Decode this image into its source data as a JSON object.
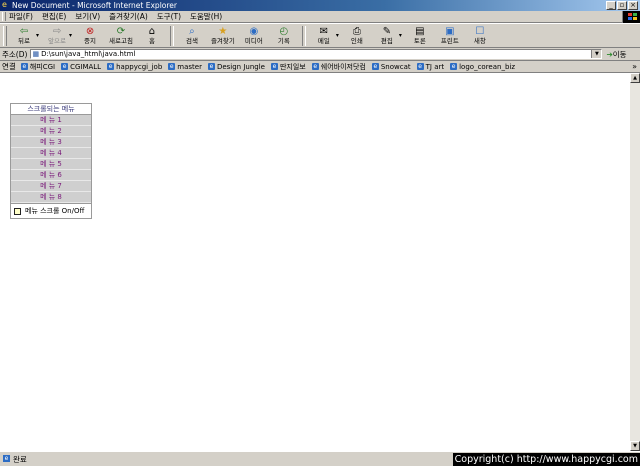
{
  "window": {
    "title": "New Document - Microsoft Internet Explorer",
    "controls": [
      "_",
      "▫",
      "×"
    ]
  },
  "menubar": [
    "파일(F)",
    "편집(E)",
    "보기(V)",
    "즐겨찾기(A)",
    "도구(T)",
    "도움말(H)"
  ],
  "toolbar": {
    "back": "뒤로",
    "forward": "앞으로",
    "stop": "중지",
    "refresh": "새로고침",
    "home": "홈",
    "search": "검색",
    "favorites": "즐겨찾기",
    "media": "미디어",
    "history": "기록",
    "mail": "메일",
    "print": "인쇄",
    "edit": "편집",
    "discuss": "토론",
    "print2": "프린트",
    "messenger": "새창"
  },
  "address": {
    "label": "주소(D)",
    "url": "D:\\sun\\java_html\\java.html",
    "go": "이동"
  },
  "links": {
    "label": "연결",
    "items": [
      "해피CGI",
      "CGIMALL",
      "happycgi_job",
      "master",
      "Design Jungle",
      "딴지일보",
      "쉐어바이저닷컴",
      "Snowcat",
      "TJ art",
      "logo_corean_biz"
    ],
    "more": "»"
  },
  "page": {
    "menu_title": "스크롤되는 메뉴",
    "menu_items": [
      "메 뉴 1",
      "메 뉴 2",
      "메 뉴 3",
      "메 뉴 4",
      "메 뉴 5",
      "메 뉴 6",
      "메 뉴 7",
      "메 뉴 8"
    ],
    "toggle_label": "메뉴 스크롤 On/Off"
  },
  "status": {
    "text": "완료",
    "copyright": "Copyright(c) http://www.happycgi.com"
  },
  "colors": {
    "titlebar": "#0a246a",
    "menu_item_text": "#7a1a7a",
    "menu_item_bg": "#cfcfcf"
  }
}
